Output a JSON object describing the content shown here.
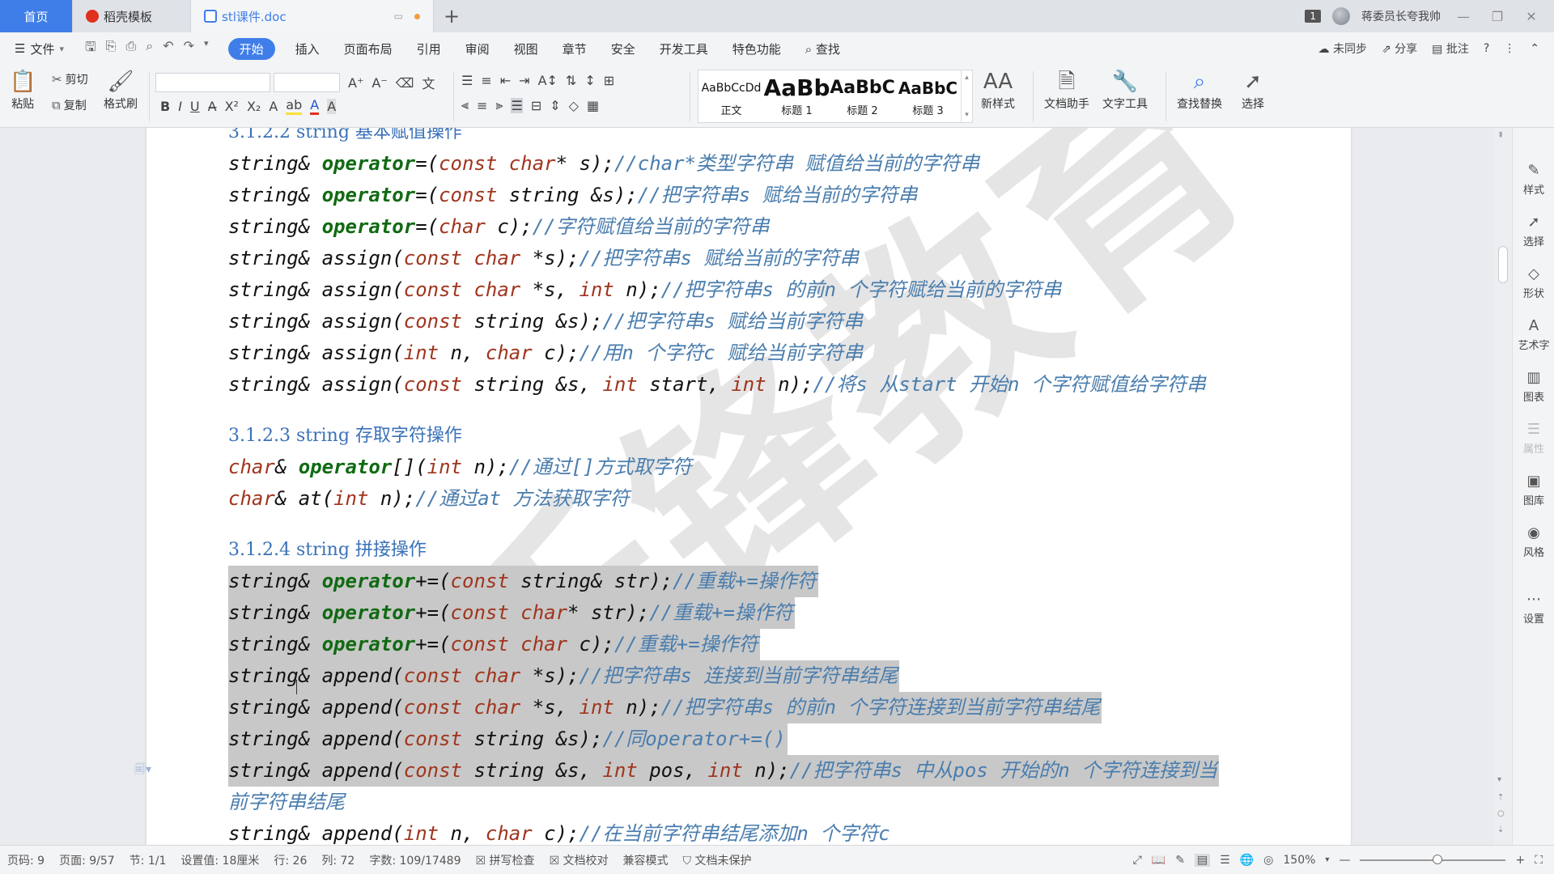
{
  "titlebar": {
    "tabs": [
      {
        "label": "首页"
      },
      {
        "label": "稻壳模板"
      },
      {
        "label": "stl课件.doc"
      }
    ],
    "new_tab": "+",
    "window_badge": "1",
    "user_name": "蒋委员长夸我帅",
    "controls": [
      "—",
      "❐",
      "✕"
    ]
  },
  "menubar": {
    "file": "文件",
    "items": [
      "开始",
      "插入",
      "页面布局",
      "引用",
      "审阅",
      "视图",
      "章节",
      "安全",
      "开发工具",
      "特色功能"
    ],
    "active": "开始",
    "search": "查找",
    "right": {
      "sync": "未同步",
      "share": "分享",
      "comment": "批注",
      "help": "?",
      "more": "⋮"
    }
  },
  "ribbon": {
    "paste": "粘贴",
    "cut": "剪切",
    "copy": "复制",
    "format_painter": "格式刷",
    "styles": [
      {
        "sample": "AaBbCcDd",
        "name": "正文"
      },
      {
        "sample": "AaBb",
        "name": "标题 1"
      },
      {
        "sample": "AaBbC",
        "name": "标题 2"
      },
      {
        "sample": "AaBbC",
        "name": "标题 3"
      }
    ],
    "new_style": "新样式",
    "doc_helper": "文档助手",
    "text_tools": "文字工具",
    "find_replace": "查找替换",
    "select": "选择"
  },
  "document": {
    "top_heading": "3.1.2.2 string 基本赋值操作",
    "assign_lines": [
      [
        {
          "t": "string& ",
          "c": ""
        },
        {
          "t": "operator",
          "c": "fn"
        },
        {
          "t": "=(",
          "c": ""
        },
        {
          "t": "const",
          "c": "kw"
        },
        {
          "t": " ",
          "c": ""
        },
        {
          "t": "char",
          "c": "kw"
        },
        {
          "t": "* s);",
          "c": ""
        },
        {
          "t": "//char*类型字符串 赋值给当前的字符串",
          "c": "cm"
        }
      ],
      [
        {
          "t": "string& ",
          "c": ""
        },
        {
          "t": "operator",
          "c": "fn"
        },
        {
          "t": "=(",
          "c": ""
        },
        {
          "t": "const",
          "c": "kw"
        },
        {
          "t": " string &s);",
          "c": ""
        },
        {
          "t": "//把字符串s 赋给当前的字符串",
          "c": "cm"
        }
      ],
      [
        {
          "t": "string& ",
          "c": ""
        },
        {
          "t": "operator",
          "c": "fn"
        },
        {
          "t": "=(",
          "c": ""
        },
        {
          "t": "char",
          "c": "kw"
        },
        {
          "t": " c);",
          "c": ""
        },
        {
          "t": "//字符赋值给当前的字符串",
          "c": "cm"
        }
      ],
      [
        {
          "t": "string& assign(",
          "c": ""
        },
        {
          "t": "const",
          "c": "kw"
        },
        {
          "t": " ",
          "c": ""
        },
        {
          "t": "char",
          "c": "kw"
        },
        {
          "t": " *s);",
          "c": ""
        },
        {
          "t": "//把字符串s 赋给当前的字符串",
          "c": "cm"
        }
      ],
      [
        {
          "t": "string& assign(",
          "c": ""
        },
        {
          "t": "const",
          "c": "kw"
        },
        {
          "t": " ",
          "c": ""
        },
        {
          "t": "char",
          "c": "kw"
        },
        {
          "t": " *s, ",
          "c": ""
        },
        {
          "t": "int",
          "c": "kw"
        },
        {
          "t": " n);",
          "c": ""
        },
        {
          "t": "//把字符串s 的前n 个字符赋给当前的字符串",
          "c": "cm"
        }
      ],
      [
        {
          "t": "string& assign(",
          "c": ""
        },
        {
          "t": "const",
          "c": "kw"
        },
        {
          "t": " string &s);",
          "c": ""
        },
        {
          "t": "//把字符串s 赋给当前字符串",
          "c": "cm"
        }
      ],
      [
        {
          "t": "string& assign(",
          "c": ""
        },
        {
          "t": "int",
          "c": "kw"
        },
        {
          "t": " n, ",
          "c": ""
        },
        {
          "t": "char",
          "c": "kw"
        },
        {
          "t": " c);",
          "c": ""
        },
        {
          "t": "//用n 个字符c 赋给当前字符串",
          "c": "cm"
        }
      ],
      [
        {
          "t": "string& assign(",
          "c": ""
        },
        {
          "t": "const",
          "c": "kw"
        },
        {
          "t": " string &s, ",
          "c": ""
        },
        {
          "t": "int",
          "c": "kw"
        },
        {
          "t": " start, ",
          "c": ""
        },
        {
          "t": "int",
          "c": "kw"
        },
        {
          "t": " n);",
          "c": ""
        },
        {
          "t": "//将s 从start 开始n 个字符赋值给字符串",
          "c": "cm"
        }
      ]
    ],
    "access_heading": "3.1.2.3 string 存取字符操作",
    "access_lines": [
      [
        {
          "t": "char",
          "c": "kw"
        },
        {
          "t": "& ",
          "c": ""
        },
        {
          "t": "operator",
          "c": "fn"
        },
        {
          "t": "[](",
          "c": ""
        },
        {
          "t": "int",
          "c": "kw"
        },
        {
          "t": " n);",
          "c": ""
        },
        {
          "t": "//通过[]方式取字符",
          "c": "cm"
        }
      ],
      [
        {
          "t": "char",
          "c": "kw"
        },
        {
          "t": "& at(",
          "c": ""
        },
        {
          "t": "int",
          "c": "kw"
        },
        {
          "t": " n);",
          "c": ""
        },
        {
          "t": "//通过at 方法获取字符",
          "c": "cm"
        }
      ]
    ],
    "concat_heading": "3.1.2.4 string 拼接操作",
    "concat_lines": [
      {
        "hl": true,
        "segs": [
          {
            "t": "string& ",
            "c": ""
          },
          {
            "t": "operator",
            "c": "fn"
          },
          {
            "t": "+=(",
            "c": ""
          },
          {
            "t": "const",
            "c": "kw"
          },
          {
            "t": " string& str);",
            "c": ""
          },
          {
            "t": "//重载+=操作符",
            "c": "cm"
          }
        ]
      },
      {
        "hl": true,
        "segs": [
          {
            "t": "string& ",
            "c": ""
          },
          {
            "t": "operator",
            "c": "fn"
          },
          {
            "t": "+=(",
            "c": ""
          },
          {
            "t": "const",
            "c": "kw"
          },
          {
            "t": " ",
            "c": ""
          },
          {
            "t": "char",
            "c": "kw"
          },
          {
            "t": "* str);",
            "c": ""
          },
          {
            "t": "//重载+=操作符",
            "c": "cm"
          }
        ]
      },
      {
        "hl": true,
        "segs": [
          {
            "t": "string& ",
            "c": ""
          },
          {
            "t": "operator",
            "c": "fn"
          },
          {
            "t": "+=(",
            "c": ""
          },
          {
            "t": "const",
            "c": "kw"
          },
          {
            "t": " ",
            "c": ""
          },
          {
            "t": "char",
            "c": "kw"
          },
          {
            "t": " c);",
            "c": ""
          },
          {
            "t": "//重载+=操作符",
            "c": "cm"
          }
        ]
      },
      {
        "hl": true,
        "segs": [
          {
            "t": "string& append(",
            "c": ""
          },
          {
            "t": "const",
            "c": "kw"
          },
          {
            "t": " ",
            "c": ""
          },
          {
            "t": "char",
            "c": "kw"
          },
          {
            "t": " *s);",
            "c": ""
          },
          {
            "t": "//把字符串s 连接到当前字符串结尾",
            "c": "cm"
          }
        ]
      },
      {
        "hl": true,
        "segs": [
          {
            "t": "string& append(",
            "c": ""
          },
          {
            "t": "const",
            "c": "kw"
          },
          {
            "t": " ",
            "c": ""
          },
          {
            "t": "char",
            "c": "kw"
          },
          {
            "t": " *s, ",
            "c": ""
          },
          {
            "t": "int",
            "c": "kw"
          },
          {
            "t": " n);",
            "c": ""
          },
          {
            "t": "//把字符串s 的前n 个字符连接到当前字符串结尾",
            "c": "cm"
          }
        ]
      },
      {
        "hl": true,
        "segs": [
          {
            "t": "string& append(",
            "c": ""
          },
          {
            "t": "const",
            "c": "kw"
          },
          {
            "t": " string &s);",
            "c": ""
          },
          {
            "t": "//同operator+=()",
            "c": "cm"
          }
        ]
      },
      {
        "hl": true,
        "segs": [
          {
            "t": "string& append(",
            "c": ""
          },
          {
            "t": "const",
            "c": "kw"
          },
          {
            "t": " string &s, ",
            "c": ""
          },
          {
            "t": "int",
            "c": "kw"
          },
          {
            "t": " pos, ",
            "c": ""
          },
          {
            "t": "int",
            "c": "kw"
          },
          {
            "t": " n);",
            "c": ""
          },
          {
            "t": "//把字符串s 中从pos 开始的n 个字符连接到当",
            "c": "cm"
          }
        ]
      },
      {
        "hl": false,
        "segs": [
          {
            "t": "前字符串结尾",
            "c": "cm"
          }
        ]
      },
      {
        "hl": false,
        "segs": [
          {
            "t": "string& append(",
            "c": ""
          },
          {
            "t": "int",
            "c": "kw"
          },
          {
            "t": " n, ",
            "c": ""
          },
          {
            "t": "char",
            "c": "kw"
          },
          {
            "t": " c);",
            "c": ""
          },
          {
            "t": "//在当前字符串结尾添加n 个字符c",
            "c": "cm"
          }
        ]
      }
    ],
    "watermark": "千锋教育"
  },
  "rightbar": [
    {
      "icon": "pen-icon",
      "label": "样式"
    },
    {
      "icon": "cursor-icon",
      "label": "选择"
    },
    {
      "icon": "shape-icon",
      "label": "形状"
    },
    {
      "icon": "art-text-icon",
      "label": "艺术字"
    },
    {
      "icon": "chart-icon",
      "label": "图表"
    },
    {
      "icon": "property-icon",
      "label": "属性"
    },
    {
      "icon": "gallery-icon",
      "label": "图库"
    },
    {
      "icon": "style-icon",
      "label": "风格"
    },
    {
      "icon": "more-icon",
      "label": "设置"
    }
  ],
  "statusbar": {
    "page_code": "页码: 9",
    "page": "页面: 9/57",
    "section": "节: 1/1",
    "setting": "设置值: 18厘米",
    "row": "行: 26",
    "col": "列: 72",
    "words": "字数: 109/17489",
    "spell": "拼写检查",
    "proof": "文档校对",
    "compat": "兼容模式",
    "protect": "文档未保护",
    "zoom": "150%"
  },
  "colors": {
    "accent": "#3f7ee8",
    "keyword": "#a0351e",
    "operator": "#106a12",
    "comment": "#4a7dad",
    "heading": "#3a72b8",
    "selection": "#c8c8c8"
  }
}
